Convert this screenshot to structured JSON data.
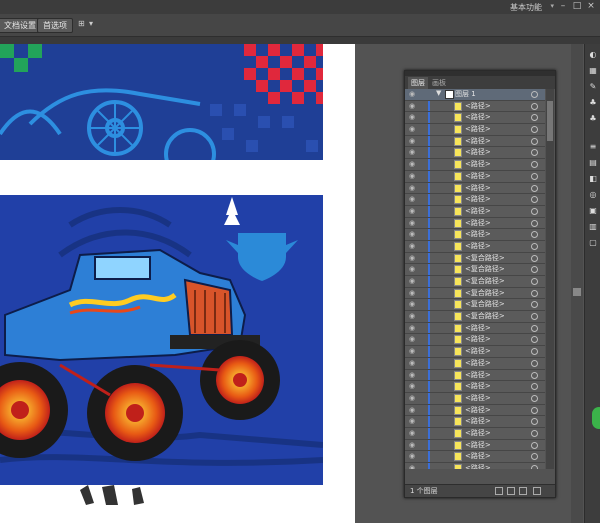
{
  "topbar": {
    "workspace_label": "基本功能",
    "workspace_arrow": "▾",
    "min_glyph": "–",
    "max_glyph": "□",
    "close_glyph": "×"
  },
  "controlbar": {
    "doc_setup_label": "文档设置",
    "preferences_label": "首选项",
    "arrange_glyph": "⊞",
    "dropdown_glyph": "▾"
  },
  "layers_panel": {
    "tabs": [
      "图层",
      "画板"
    ],
    "top_layer_name": "图层 1",
    "rows": [
      "<路径>",
      "<路径>",
      "<路径>",
      "<路径>",
      "<路径>",
      "<路径>",
      "<路径>",
      "<路径>",
      "<路径>",
      "<路径>",
      "<路径>",
      "<路径>",
      "<路径>",
      "<复合路径>",
      "<复合路径>",
      "<复合路径>",
      "<复合路径>",
      "<复合路径>",
      "<复合路径>",
      "<路径>",
      "<路径>",
      "<路径>",
      "<路径>",
      "<路径>",
      "<路径>",
      "<路径>",
      "<路径>",
      "<路径>",
      "<路径>",
      "<路径>",
      "<路径>",
      "<路径>",
      "<路径>",
      "<路径>"
    ],
    "footer_count": "1 个图层",
    "accent_color": "#3b6fd8",
    "thumbnail_color": "#f7e55a"
  },
  "icons": {
    "eye": "◉",
    "dock_icons": [
      "palette-icon",
      "swatches-icon",
      "brushes-icon",
      "symbols-icon",
      "club-icon",
      "stroke-icon",
      "gradient-icon",
      "transparency-icon",
      "appearance-icon",
      "graphic-styles-icon",
      "layers-icon",
      "artboards-icon"
    ]
  }
}
